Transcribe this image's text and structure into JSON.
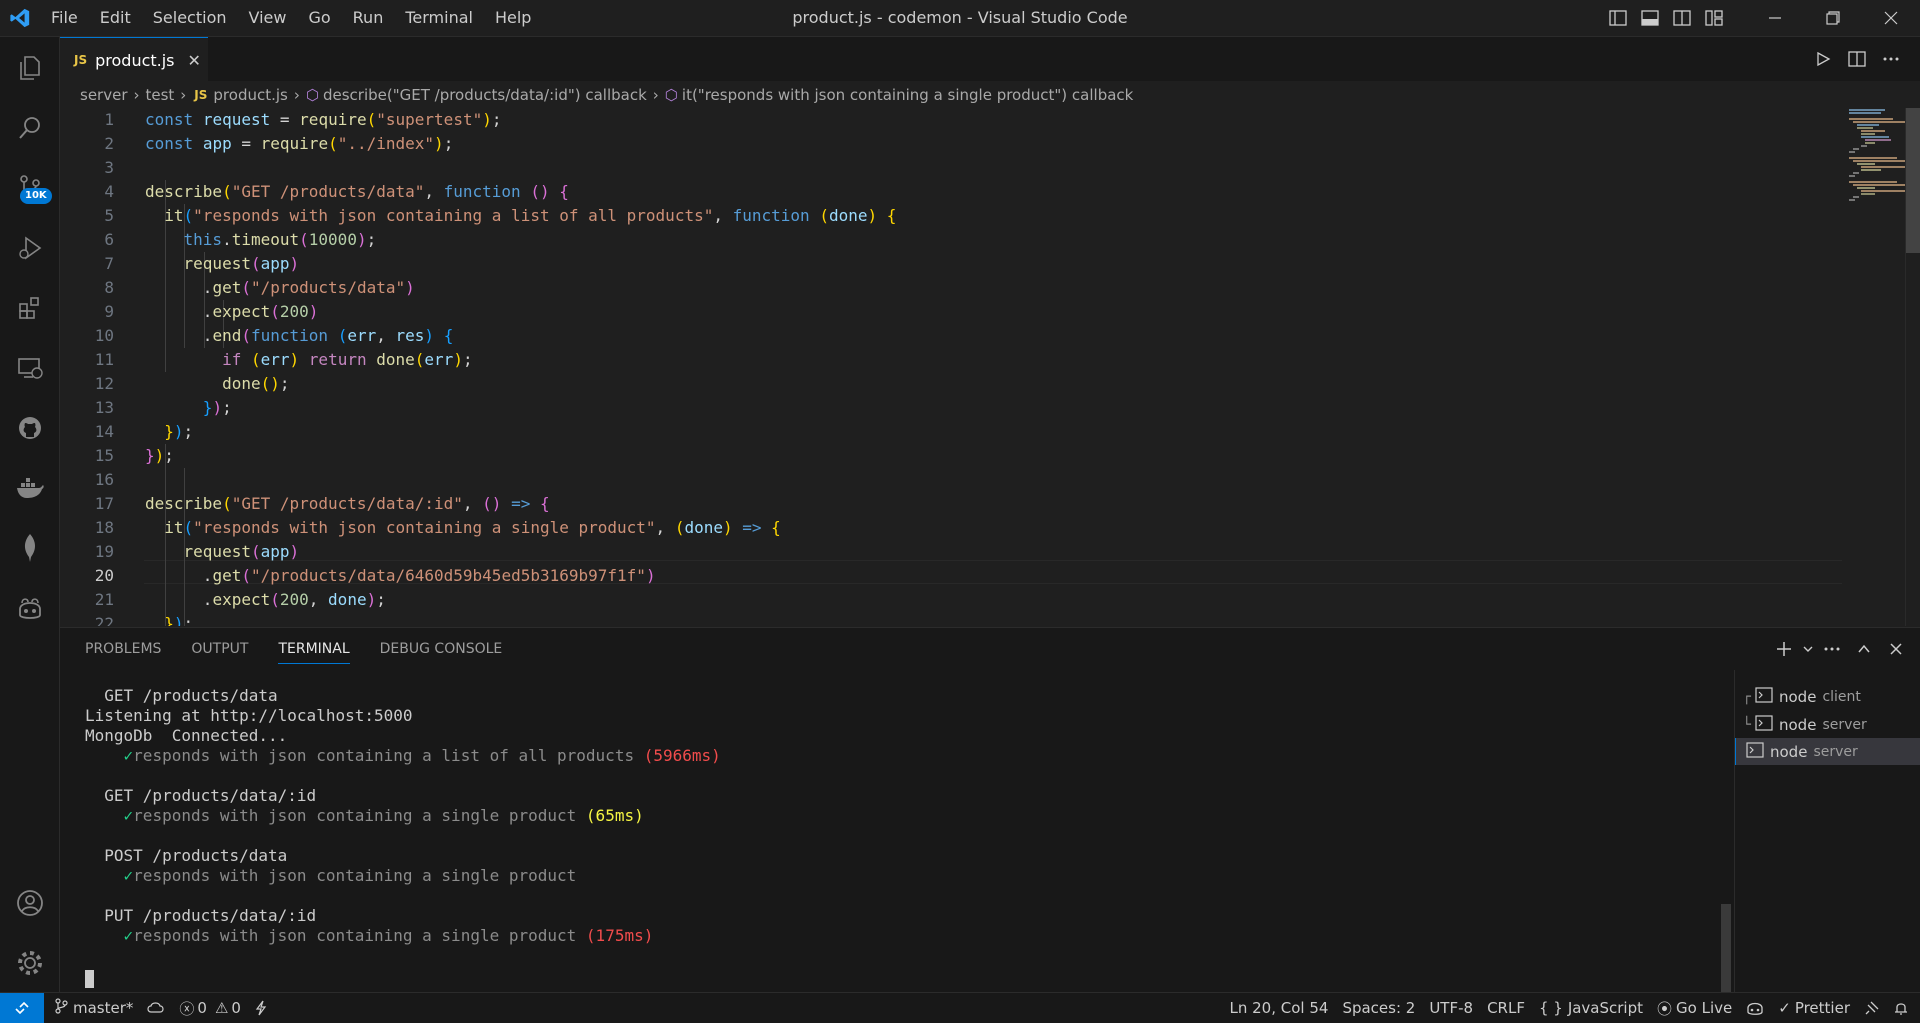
{
  "titlebar": {
    "menu": [
      "File",
      "Edit",
      "Selection",
      "View",
      "Go",
      "Run",
      "Terminal",
      "Help"
    ],
    "window_title": "product.js - codemon - Visual Studio Code"
  },
  "activity": {
    "scm_badge": "10K"
  },
  "tab": {
    "label": "product.js",
    "file_type_icon": "JS"
  },
  "breadcrumb": {
    "folder1": "server",
    "folder2": "test",
    "file": "product.js",
    "symbol1": "describe(\"GET /products/data/:id\") callback",
    "symbol2": "it(\"responds with json containing a single product\") callback"
  },
  "editor": {
    "line_numbers": [
      "1",
      "2",
      "3",
      "4",
      "5",
      "6",
      "7",
      "8",
      "9",
      "10",
      "11",
      "12",
      "13",
      "14",
      "15",
      "16",
      "17",
      "18",
      "19",
      "20",
      "21",
      "22"
    ],
    "current_line": "20"
  },
  "panel": {
    "tabs": [
      "PROBLEMS",
      "OUTPUT",
      "TERMINAL",
      "DEBUG CONSOLE"
    ],
    "active_tab": "TERMINAL",
    "terminal_lines": {
      "l1": "  GET /products/data",
      "l2": "Listening at http://localhost:5000",
      "l3": "MongoDb  Connected...",
      "l4_text": "responds with json containing a list of all products",
      "l4_time": "(5966ms)",
      "l5": "  GET /products/data/:id",
      "l6_text": "responds with json containing a single product",
      "l6_time": "(65ms)",
      "l7": "  POST /products/data",
      "l8_text": "responds with json containing a single product",
      "l9": "  PUT /products/data/:id",
      "l10_text": "responds with json containing a single product",
      "l10_time": "(175ms)",
      "check": "✓"
    },
    "terminals": [
      {
        "name": "node",
        "sub": "client"
      },
      {
        "name": "node",
        "sub": "server"
      },
      {
        "name": "node",
        "sub": "server"
      }
    ]
  },
  "statusbar": {
    "branch": "master*",
    "errors": "0",
    "warnings": "0",
    "position": "Ln 20, Col 54",
    "spaces": "Spaces: 2",
    "encoding": "UTF-8",
    "eol": "CRLF",
    "language": "JavaScript",
    "golive": "Go Live",
    "prettier": "Prettier"
  },
  "colors": {
    "accent": "#0078d4",
    "success": "#23d18b",
    "error": "#f14c4c",
    "warning": "#f5f543"
  },
  "icons": [
    "vscode-logo-icon",
    "explorer-icon",
    "search-icon",
    "source-control-icon",
    "run-debug-icon",
    "extensions-icon",
    "remote-explorer-icon",
    "github-icon",
    "docker-icon",
    "mongodb-leaf-icon",
    "copilot-icon",
    "account-icon",
    "settings-gear-icon"
  ]
}
